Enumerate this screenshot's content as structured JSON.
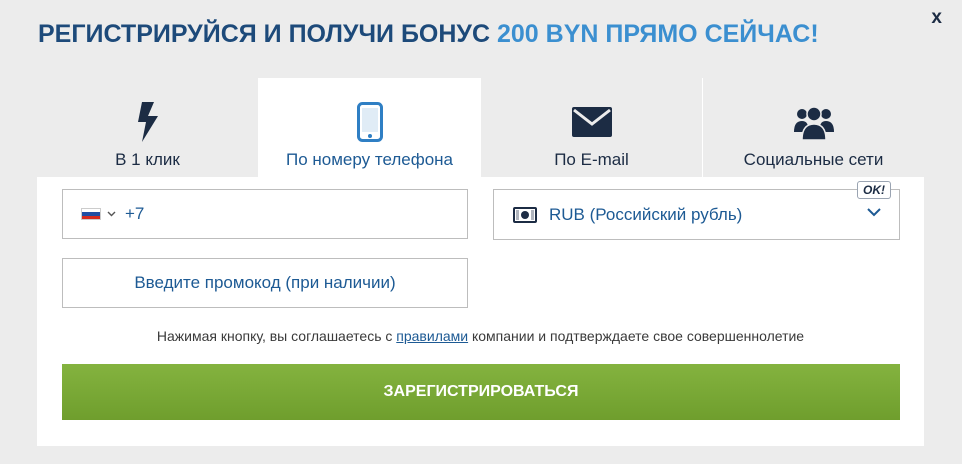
{
  "header": {
    "title_main": "РЕГИСТРИРУЙСЯ И ПОЛУЧИ БОНУС ",
    "title_accent": "200 BYN ПРЯМО СЕЙЧАС!",
    "close_label": "x"
  },
  "tabs": [
    {
      "label": "В 1 клик",
      "icon": "lightning-icon",
      "active": false
    },
    {
      "label": "По номеру телефона",
      "icon": "phone-icon",
      "active": true
    },
    {
      "label": "По E-mail",
      "icon": "envelope-icon",
      "active": false
    },
    {
      "label": "Социальные сети",
      "icon": "users-icon",
      "active": false
    }
  ],
  "form": {
    "phone_prefix": "+7",
    "country_flag": "russia-flag-icon",
    "currency_value": "RUB (Российский рубль)",
    "currency_badge": "OK!",
    "promo_placeholder": "Введите промокод (при наличии)",
    "terms_before": "Нажимая кнопку, вы соглашаетесь с ",
    "terms_link": "правилами",
    "terms_after": " компании и подтверждаете свое совершеннолетие",
    "submit_label": "ЗАРЕГИСТРИРОВАТЬСЯ"
  },
  "colors": {
    "title": "#1d4a7a",
    "accent": "#3b8fd0",
    "button": "#78a735",
    "link": "#1d5a94"
  }
}
